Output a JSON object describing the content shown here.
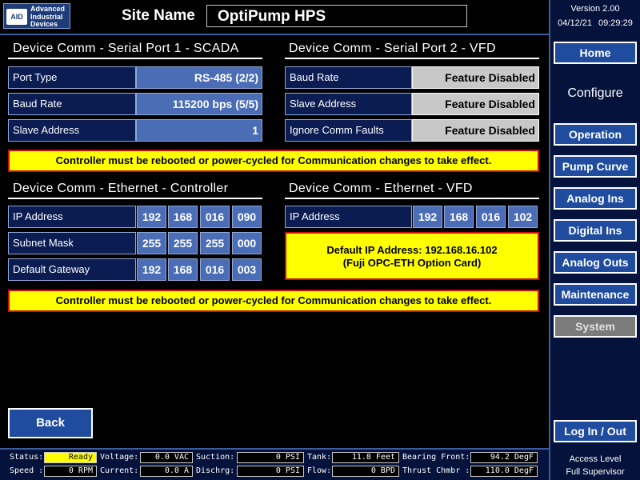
{
  "header": {
    "logo_mark": "AID",
    "logo_lines": [
      "Advanced",
      "Industrial",
      "Devices"
    ],
    "site_label": "Site Name",
    "site_value": "OptiPump HPS"
  },
  "sidebar": {
    "version": "Version 2.00",
    "date": "04/12/21",
    "time": "09:29:29",
    "home": "Home",
    "configure": "Configure",
    "items": [
      {
        "label": "Operation"
      },
      {
        "label": "Pump Curve"
      },
      {
        "label": "Analog Ins"
      },
      {
        "label": "Digital Ins"
      },
      {
        "label": "Analog Outs"
      },
      {
        "label": "Maintenance"
      },
      {
        "label": "System",
        "active": true
      }
    ],
    "logout": "Log In / Out",
    "access_label": "Access Level",
    "access_value": "Full Supervisor"
  },
  "serial1": {
    "title": "Device Comm - Serial Port 1 - SCADA",
    "rows": [
      {
        "label": "Port Type",
        "value": "RS-485 (2/2)"
      },
      {
        "label": "Baud Rate",
        "value": "115200 bps (5/5)"
      },
      {
        "label": "Slave Address",
        "value": "1"
      }
    ]
  },
  "serial2": {
    "title": "Device Comm - Serial Port 2 - VFD",
    "rows": [
      {
        "label": "Baud Rate",
        "value": "Feature Disabled"
      },
      {
        "label": "Slave Address",
        "value": "Feature Disabled"
      },
      {
        "label": "Ignore Comm Faults",
        "value": "Feature Disabled"
      }
    ]
  },
  "warning_text": "Controller must be rebooted or power-cycled for Communication changes to take effect.",
  "eth_controller": {
    "title": "Device Comm - Ethernet - Controller",
    "rows": [
      {
        "label": "IP Address",
        "octets": [
          "192",
          "168",
          "016",
          "090"
        ]
      },
      {
        "label": "Subnet Mask",
        "octets": [
          "255",
          "255",
          "255",
          "000"
        ]
      },
      {
        "label": "Default Gateway",
        "octets": [
          "192",
          "168",
          "016",
          "003"
        ]
      }
    ]
  },
  "eth_vfd": {
    "title": "Device Comm - Ethernet - VFD",
    "rows": [
      {
        "label": "IP Address",
        "octets": [
          "192",
          "168",
          "016",
          "102"
        ]
      }
    ],
    "note_line1": "Default IP Address: 192.168.16.102",
    "note_line2": "(Fuji OPC-ETH Option Card)"
  },
  "back_label": "Back",
  "status": {
    "status_label": "Status:",
    "status_value": "Ready",
    "speed_label": "Speed :",
    "speed_value": "0 RPM",
    "voltage_label": "Voltage:",
    "voltage_value": "0.0 VAC",
    "current_label": "Current:",
    "current_value": "0.0 A",
    "suction_label": "Suction:",
    "suction_value": "0 PSI",
    "discharge_label": "Dischrg:",
    "discharge_value": "0 PSI",
    "tank_label": "Tank:",
    "tank_value": "11.8 Feet",
    "flow_label": "Flow:",
    "flow_value": "0 BPD",
    "bearing_label": "Bearing Front:",
    "bearing_value": "94.2 DegF",
    "thrust_label": "Thrust Chmbr :",
    "thrust_value": "110.0 DegF"
  },
  "colors": {
    "accent_blue": "#1f4c9e",
    "value_blue": "#4a6db6",
    "warning_yellow": "#ffff00",
    "warning_border": "#cc1010",
    "disabled_gray": "#c8c8c8"
  }
}
